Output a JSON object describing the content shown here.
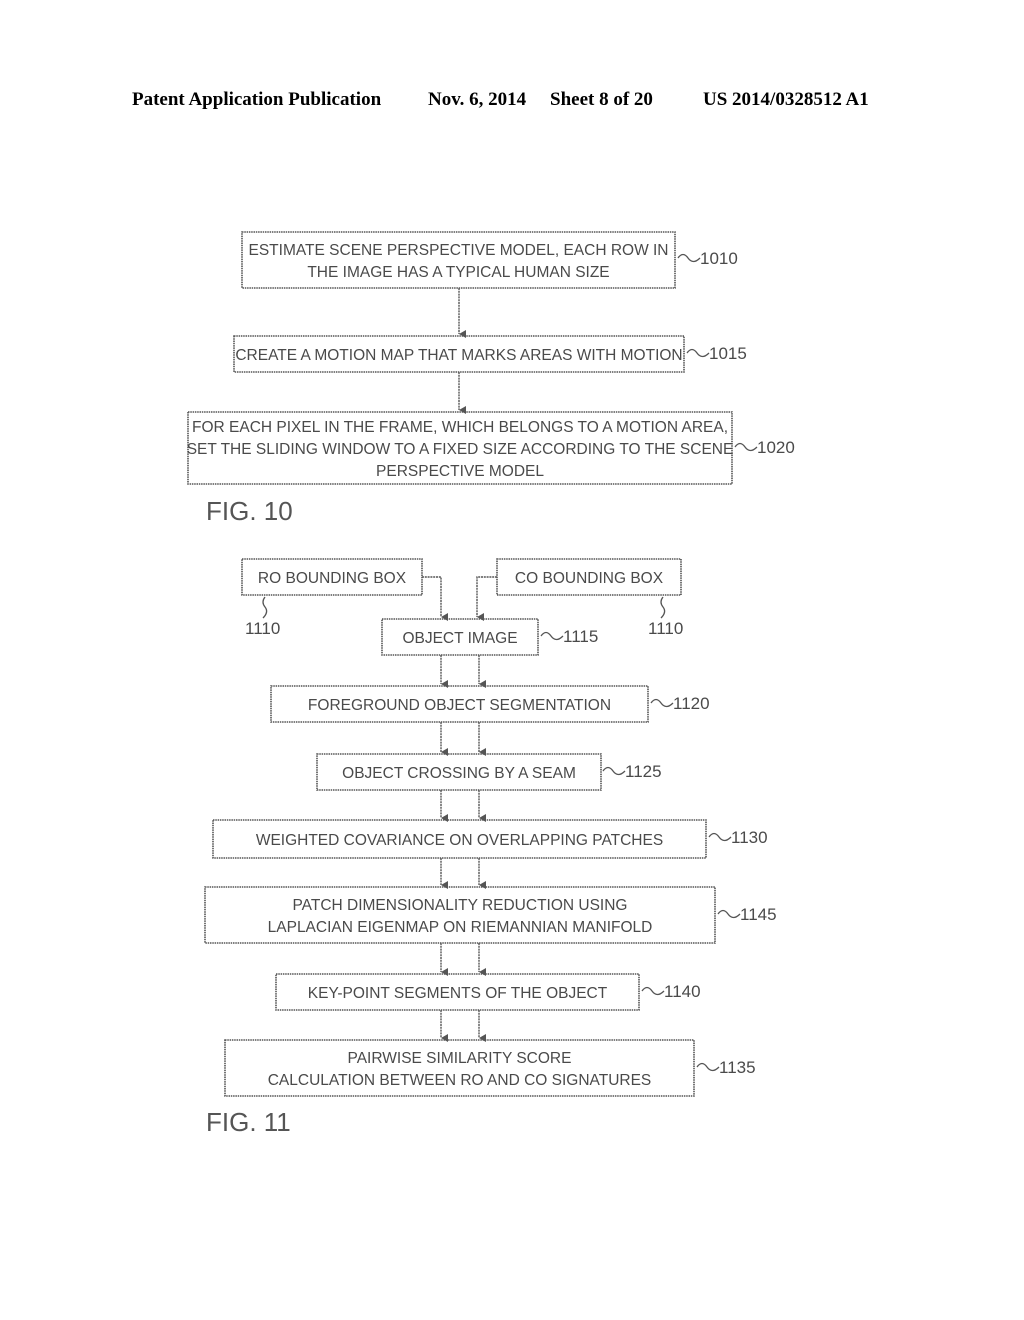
{
  "header": {
    "left": "Patent Application Publication",
    "date": "Nov. 6, 2014",
    "sheet": "Sheet 8 of 20",
    "number": "US 2014/0328512 A1"
  },
  "fig10": {
    "label": "FIG. 10",
    "steps": [
      {
        "id": "1010",
        "ref": "1010",
        "lines": [
          "ESTIMATE SCENE PERSPECTIVE MODEL, EACH ROW IN",
          "THE IMAGE HAS A TYPICAL HUMAN SIZE"
        ]
      },
      {
        "id": "1015",
        "ref": "1015",
        "lines": [
          "CREATE A MOTION MAP THAT MARKS AREAS WITH MOTION"
        ]
      },
      {
        "id": "1020",
        "ref": "1020",
        "lines": [
          "FOR EACH PIXEL IN THE FRAME, WHICH BELONGS TO A MOTION AREA,",
          "SET THE SLIDING WINDOW TO A FIXED SIZE ACCORDING TO THE SCENE",
          "PERSPECTIVE MODEL"
        ]
      }
    ]
  },
  "fig11": {
    "label": "FIG. 11",
    "inputs": [
      {
        "id": "ro",
        "ref": "1110",
        "lines": [
          "RO BOUNDING BOX"
        ]
      },
      {
        "id": "co",
        "ref": "1110",
        "lines": [
          "CO BOUNDING BOX"
        ]
      }
    ],
    "steps": [
      {
        "id": "1115",
        "ref": "1115",
        "lines": [
          "OBJECT IMAGE"
        ]
      },
      {
        "id": "1120",
        "ref": "1120",
        "lines": [
          "FOREGROUND OBJECT SEGMENTATION"
        ]
      },
      {
        "id": "1125",
        "ref": "1125",
        "lines": [
          "OBJECT CROSSING BY A SEAM"
        ]
      },
      {
        "id": "1130",
        "ref": "1130",
        "lines": [
          "WEIGHTED COVARIANCE ON OVERLAPPING PATCHES"
        ]
      },
      {
        "id": "1145",
        "ref": "1145",
        "lines": [
          "PATCH DIMENSIONALITY REDUCTION USING",
          "LAPLACIAN EIGENMAP ON RIEMANNIAN MANIFOLD"
        ]
      },
      {
        "id": "1140",
        "ref": "1140",
        "lines": [
          "KEY-POINT SEGMENTS OF THE OBJECT"
        ]
      },
      {
        "id": "1135",
        "ref": "1135",
        "lines": [
          "PAIRWISE SIMILARITY SCORE",
          "CALCULATION BETWEEN RO AND CO SIGNATURES"
        ]
      }
    ]
  }
}
